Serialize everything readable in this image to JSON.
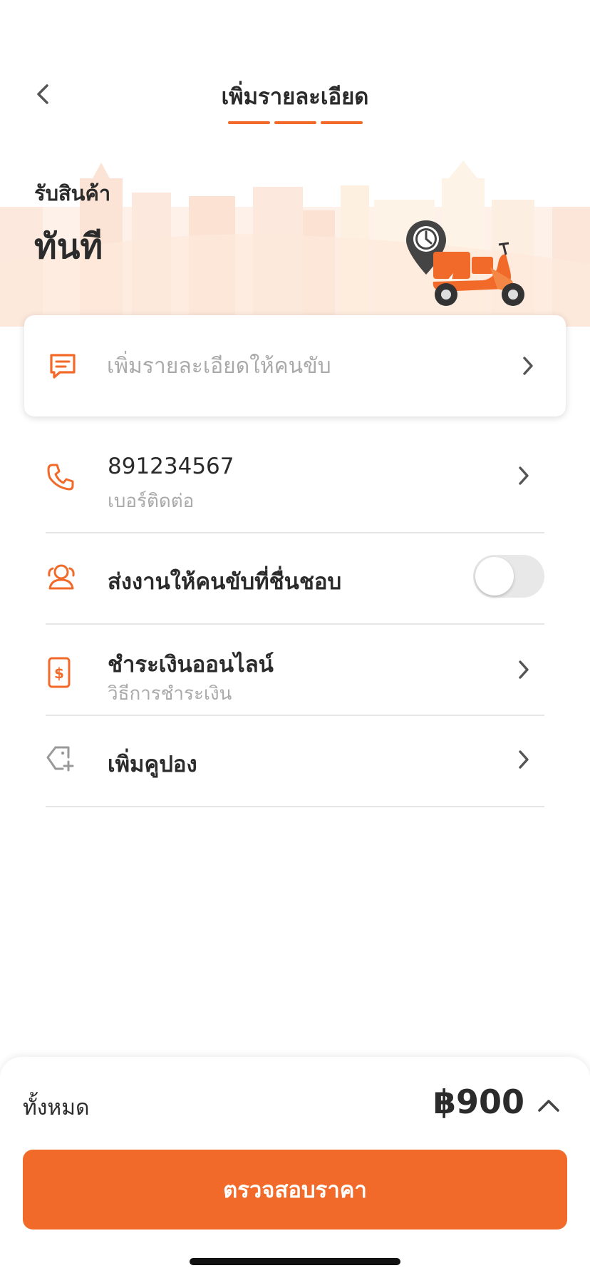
{
  "header": {
    "title": "เพิ่มรายละเอียด",
    "steps_total": 3,
    "steps_completed": 3
  },
  "pickup": {
    "label": "รับสินค้า",
    "value": "ทันที"
  },
  "notes": {
    "placeholder": "เพิ่มรายละเอียดให้คนขับ"
  },
  "contact": {
    "phone": "891234567",
    "label": "เบอร์ติดต่อ"
  },
  "favorite_driver": {
    "label": "ส่งงานให้คนขับที่ชื่นชอบ",
    "enabled": false
  },
  "payment": {
    "method": "ชำระเงินออนไลน์",
    "label": "วิธีการชำระเงิน"
  },
  "coupon": {
    "label": "เพิ่มคูปอง"
  },
  "summary": {
    "total_label": "ทั้งหมด",
    "total_value": "฿900"
  },
  "cta": {
    "label": "ตรวจสอบราคา"
  },
  "colors": {
    "accent": "#F26A2A",
    "text": "#2B2B2B",
    "muted": "#A9A9A9"
  }
}
